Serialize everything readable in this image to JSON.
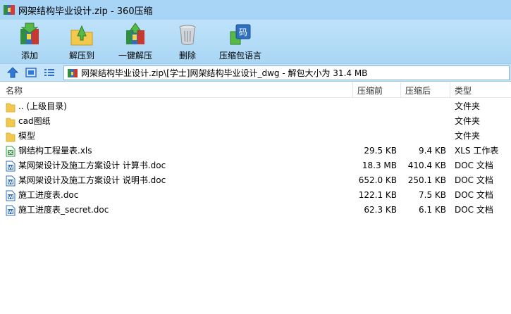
{
  "title": "网架结构毕业设计.zip - 360压缩",
  "toolbar": {
    "add": "添加",
    "extract_to": "解压到",
    "one_click_extract": "一键解压",
    "delete": "删除",
    "encoding": "压缩包语言"
  },
  "address": {
    "path": "网架结构毕业设计.zip\\[学士]网架结构毕业设计_dwg - 解包大小为 31.4 MB"
  },
  "columns": {
    "name": "名称",
    "packed": "压缩前",
    "size": "压缩后",
    "type": "类型"
  },
  "files": [
    {
      "icon": "folder-icon",
      "name": ".. (上级目录)",
      "packed": "",
      "size": "",
      "type": "文件夹"
    },
    {
      "icon": "folder-icon",
      "name": "cad图纸",
      "packed": "",
      "size": "",
      "type": "文件夹"
    },
    {
      "icon": "folder-icon",
      "name": "模型",
      "packed": "",
      "size": "",
      "type": "文件夹"
    },
    {
      "icon": "xls-file-icon",
      "name": "钢结构工程量表.xls",
      "packed": "29.5 KB",
      "size": "9.4 KB",
      "type": "XLS 工作表"
    },
    {
      "icon": "doc-file-icon",
      "name": "某网架设计及施工方案设计 计算书.doc",
      "packed": "18.3 MB",
      "size": "410.4 KB",
      "type": "DOC 文档"
    },
    {
      "icon": "doc-file-icon",
      "name": "某网架设计及施工方案设计 说明书.doc",
      "packed": "652.0 KB",
      "size": "250.1 KB",
      "type": "DOC 文档"
    },
    {
      "icon": "doc-file-icon",
      "name": "施工进度表.doc",
      "packed": "122.1 KB",
      "size": "7.5 KB",
      "type": "DOC 文档"
    },
    {
      "icon": "doc-file-icon",
      "name": "施工进度表_secret.doc",
      "packed": "62.3 KB",
      "size": "6.1 KB",
      "type": "DOC 文档"
    }
  ],
  "colors": {
    "title_bg": "#a8d4f5",
    "toolbar_bg": "#b6ddf8",
    "folder": "#f2c94c",
    "doc_blue": "#2f6fbf",
    "xls_green": "#2e9a3e"
  }
}
